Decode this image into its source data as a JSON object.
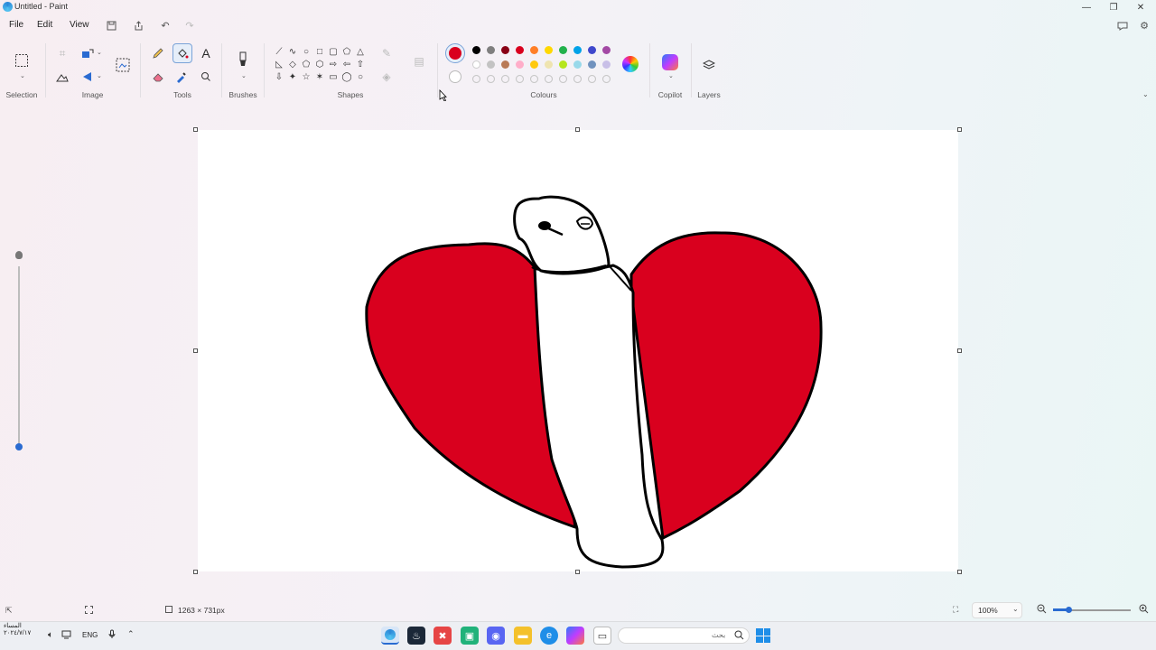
{
  "window": {
    "title": "Untitled - Paint",
    "minimize_icon": "minimize-icon",
    "maximize_icon": "restore-icon",
    "close_icon": "close-icon"
  },
  "menu": {
    "file": "File",
    "edit": "Edit",
    "view": "View"
  },
  "ribbon": {
    "groups": {
      "selection": "Selection",
      "image": "Image",
      "tools": "Tools",
      "brushes": "Brushes",
      "shapes": "Shapes",
      "colours": "Colours",
      "copilot": "Copilot",
      "layers": "Layers"
    },
    "active_tool": "fill-bucket",
    "primary_color": "#d9001e",
    "palette_row1": [
      "#000000",
      "#7f7f7f",
      "#880015",
      "#d9001e",
      "#ff7f27",
      "#ffd800",
      "#22b14c",
      "#00a2e8",
      "#3f48cc",
      "#a349a4"
    ],
    "palette_row2": [
      "#ffffff",
      "#c3c3c3",
      "#b97a57",
      "#ffaec9",
      "#ffc90e",
      "#efe4b0",
      "#b5e61d",
      "#99d9ea",
      "#7092be",
      "#c8bfe7"
    ]
  },
  "status": {
    "canvas_size": "1263 × 731px",
    "zoom": "100%",
    "zoom_level_fraction": 0.4
  },
  "left_slider": {
    "level_fraction": 0.0
  },
  "taskbar": {
    "language": "ENG",
    "search_placeholder": "بحث",
    "clock_time": "المساء",
    "clock_date": "٢٠٢٤/٧/١٧"
  }
}
